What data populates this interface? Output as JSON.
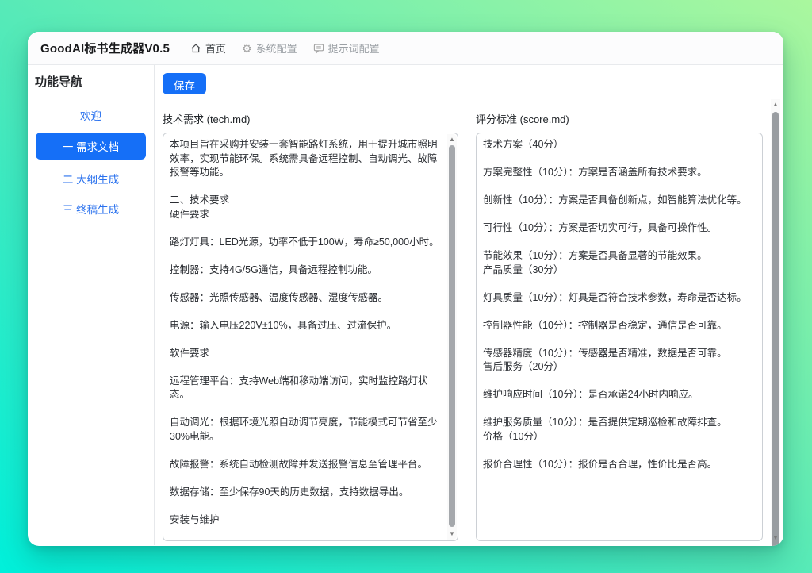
{
  "header": {
    "title": "GoodAI标书生成器V0.5",
    "nav": [
      {
        "label": "首页",
        "icon": "home-icon"
      },
      {
        "label": "系统配置",
        "icon": "gear-icon"
      },
      {
        "label": "提示词配置",
        "icon": "prompt-icon"
      }
    ]
  },
  "sidebar": {
    "title": "功能导航",
    "items": [
      {
        "label": "欢迎",
        "active": false
      },
      {
        "label": "一 需求文档",
        "active": true
      },
      {
        "label": "二 大纲生成",
        "active": false
      },
      {
        "label": "三 终稿生成",
        "active": false
      }
    ]
  },
  "main": {
    "save_label": "保存",
    "editors": {
      "tech": {
        "label": "技术需求 (tech.md)",
        "content": "本项目旨在采购并安装一套智能路灯系统，用于提升城市照明效率，实现节能环保。系统需具备远程控制、自动调光、故障报警等功能。\n\n二、技术要求\n硬件要求\n\n路灯灯具：LED光源，功率不低于100W，寿命≥50,000小时。\n\n控制器：支持4G/5G通信，具备远程控制功能。\n\n传感器：光照传感器、温度传感器、湿度传感器。\n\n电源：输入电压220V±10%，具备过压、过流保护。\n\n软件要求\n\n远程管理平台：支持Web端和移动端访问，实时监控路灯状态。\n\n自动调光：根据环境光照自动调节亮度，节能模式可节省至少30%电能。\n\n故障报警：系统自动检测故障并发送报警信息至管理平台。\n\n数据存储：至少保存90天的历史数据，支持数据导出。\n\n安装与维护\n\n安装：提供完整的安装方案，确保路灯安装稳固，布线整齐。"
      },
      "score": {
        "label": "评分标准 (score.md)",
        "content": "技术方案（40分）\n\n方案完整性（10分）：方案是否涵盖所有技术要求。\n\n创新性（10分）：方案是否具备创新点，如智能算法优化等。\n\n可行性（10分）：方案是否切实可行，具备可操作性。\n\n节能效果（10分）：方案是否具备显著的节能效果。\n产品质量（30分）\n\n灯具质量（10分）：灯具是否符合技术参数，寿命是否达标。\n\n控制器性能（10分）：控制器是否稳定，通信是否可靠。\n\n传感器精度（10分）：传感器是否精准，数据是否可靠。\n售后服务（20分）\n\n维护响应时间（10分）：是否承诺24小时内响应。\n\n维护服务质量（10分）：是否提供定期巡检和故障排查。\n价格（10分）\n\n报价合理性（10分）：报价是否合理，性价比是否高。"
      }
    }
  },
  "colors": {
    "accent_blue": "#156ff7",
    "link_blue": "#2b72ee",
    "background_gradient_start": "#00f0db",
    "background_gradient_end": "#aaf79e"
  }
}
